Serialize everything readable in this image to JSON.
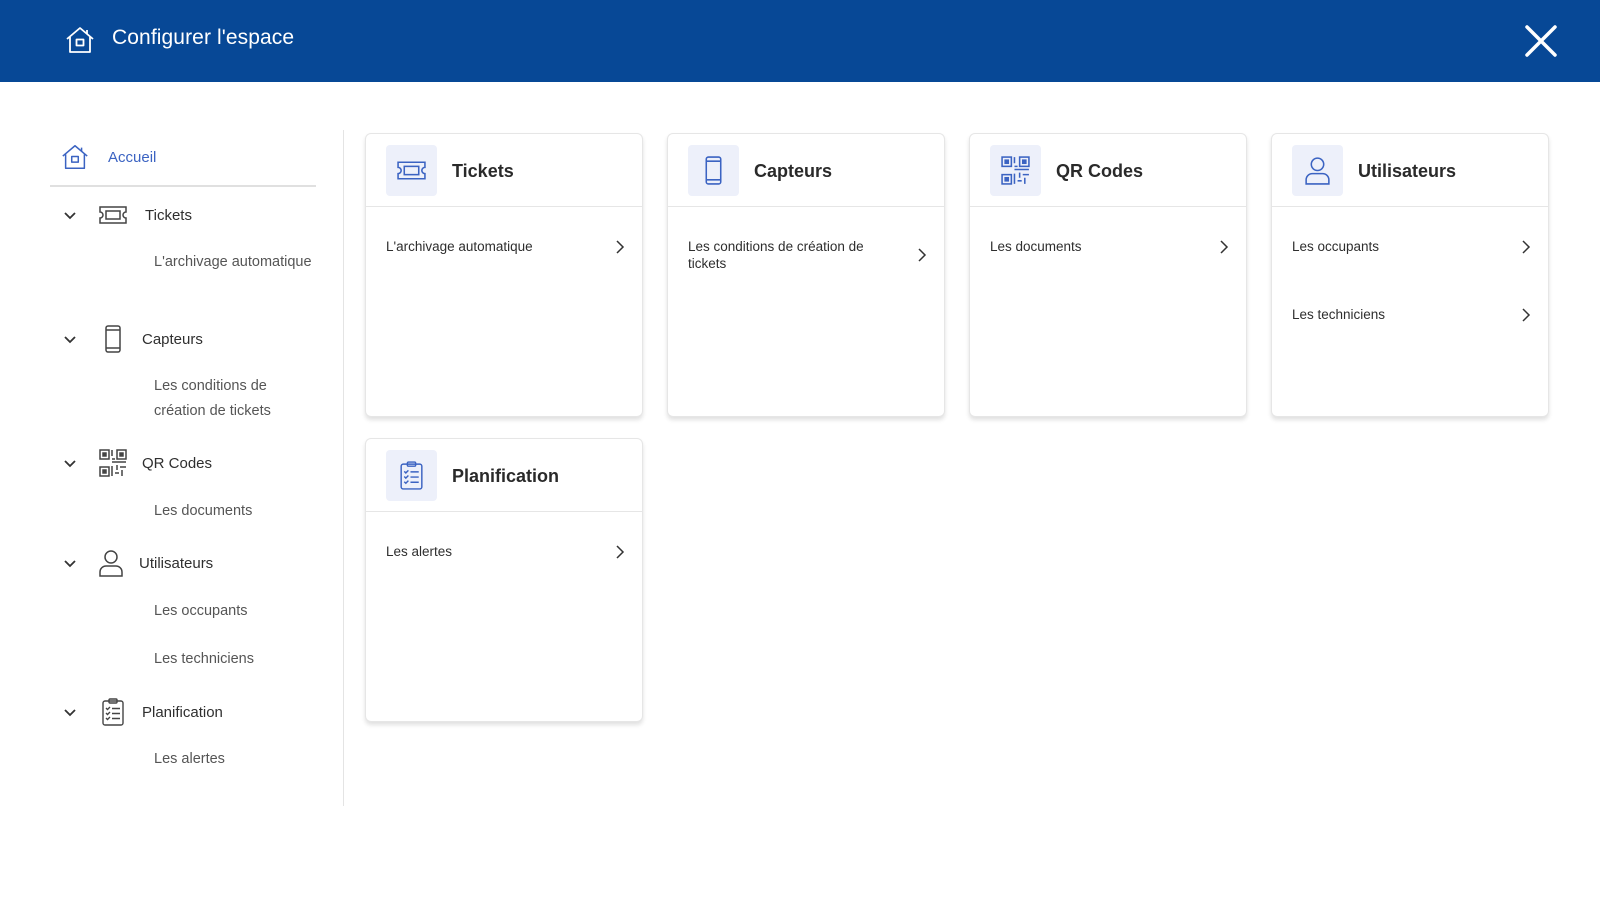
{
  "header": {
    "title": "Configurer l'espace"
  },
  "sidebar": {
    "home_label": "Accueil",
    "groups": [
      {
        "label": "Tickets",
        "items": [
          "L'archivage automatique"
        ]
      },
      {
        "label": "Capteurs",
        "items": [
          "Les conditions de création de tickets"
        ]
      },
      {
        "label": "QR Codes",
        "items": [
          "Les documents"
        ]
      },
      {
        "label": "Utilisateurs",
        "items": [
          "Les occupants",
          "Les techniciens"
        ]
      },
      {
        "label": "Planification",
        "items": [
          "Les alertes"
        ]
      }
    ]
  },
  "cards": [
    {
      "title": "Tickets",
      "icon": "ticket-icon",
      "items": [
        "L'archivage automatique"
      ]
    },
    {
      "title": "Capteurs",
      "icon": "phone-sensor-icon",
      "items": [
        "Les conditions de création de tickets"
      ]
    },
    {
      "title": "QR Codes",
      "icon": "qr-code-icon",
      "items": [
        "Les documents"
      ]
    },
    {
      "title": "Utilisateurs",
      "icon": "user-icon",
      "items": [
        "Les occupants",
        "Les techniciens"
      ]
    },
    {
      "title": "Planification",
      "icon": "clipboard-checklist-icon",
      "items": [
        "Les alertes"
      ]
    }
  ],
  "colors": {
    "header_bg": "#074896",
    "accent": "#3b63c2",
    "icon_bg": "#edf0fa"
  }
}
